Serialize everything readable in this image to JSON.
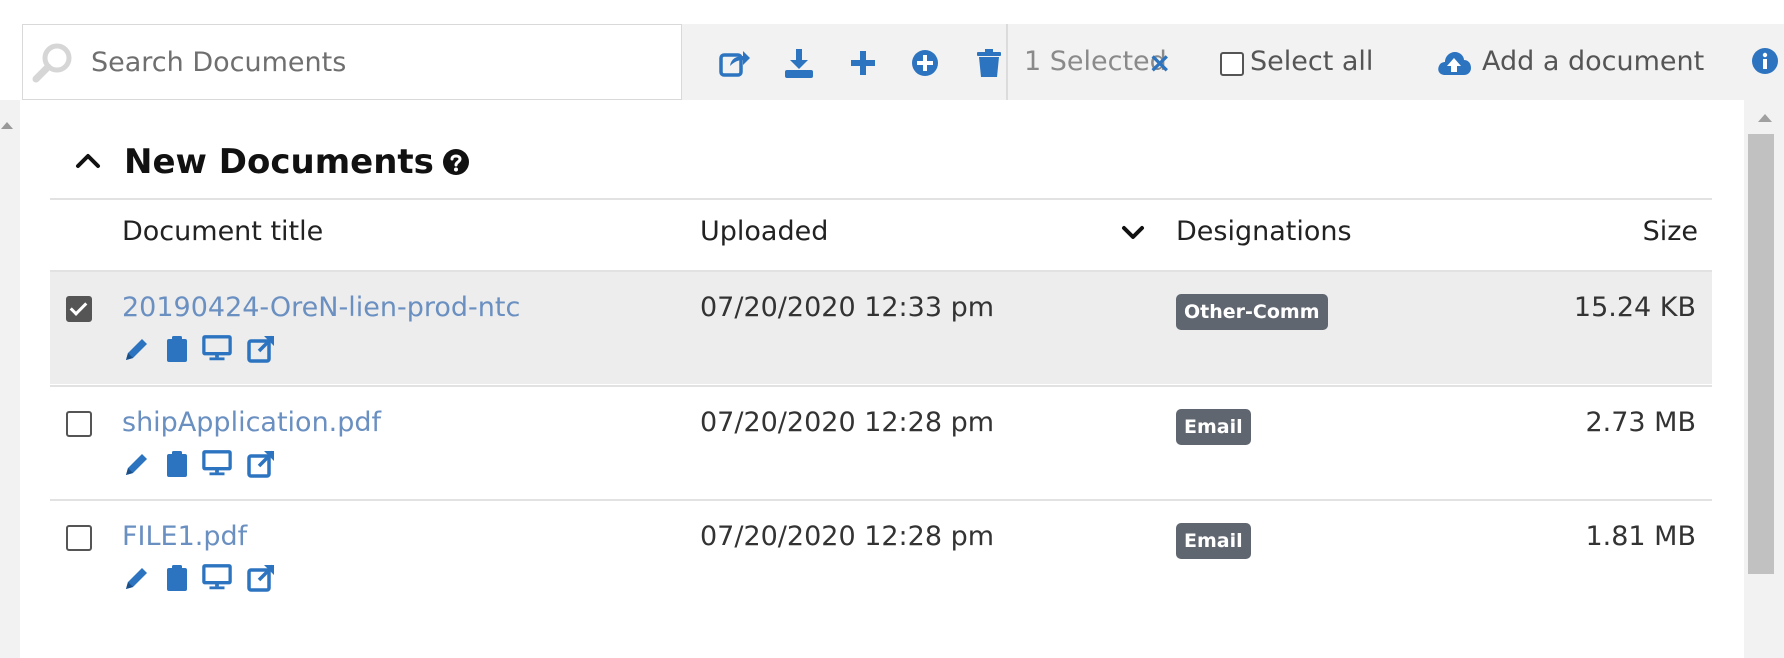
{
  "toolbar": {
    "search_placeholder": "Search Documents",
    "icons": [
      "share-icon",
      "download-icon",
      "plus-icon",
      "add-circle-icon",
      "trash-icon"
    ],
    "selected_text": "1 Selected",
    "clear_selection": "×",
    "select_all_label": "Select all",
    "add_document_label": "Add a document"
  },
  "section": {
    "title": "New Documents",
    "collapsed": false
  },
  "table": {
    "headers": {
      "title": "Document title",
      "uploaded": "Uploaded",
      "designations": "Designations",
      "size": "Size"
    },
    "rows": [
      {
        "checked": true,
        "title": "20190424-OreN-lien-prod-ntc",
        "uploaded": "07/20/2020 12:33 pm",
        "designation": "Other-Comm",
        "size": "15.24 KB"
      },
      {
        "checked": false,
        "title": "shipApplication.pdf",
        "uploaded": "07/20/2020 12:28 pm",
        "designation": "Email",
        "size": "2.73 MB"
      },
      {
        "checked": false,
        "title": "FILE1.pdf",
        "uploaded": "07/20/2020 12:28 pm",
        "designation": "Email",
        "size": "1.81 MB"
      }
    ]
  },
  "colors": {
    "accent": "#2d74c0",
    "link": "#6a8fc1",
    "badge": "#5f6670",
    "toolbar_bg": "#f2f2f2",
    "selected_row_bg": "#ededed"
  }
}
